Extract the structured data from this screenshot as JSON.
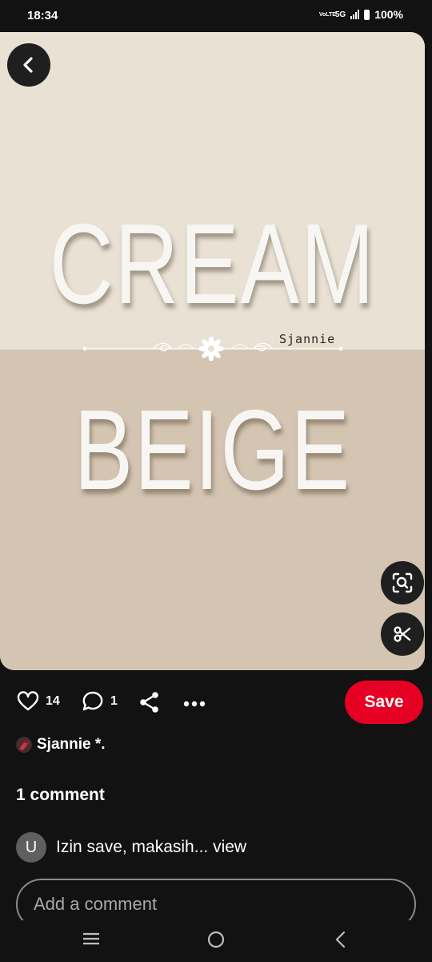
{
  "status_bar": {
    "time": "18:34",
    "volte": "VoLTE",
    "network": "5G",
    "battery": "100%"
  },
  "pin": {
    "title_word_1": "CREAM",
    "title_word_2": "BEIGE",
    "signature": "Sjannie",
    "colors": {
      "top": "#e8e1d4",
      "bottom": "#d3c5b1"
    }
  },
  "actions": {
    "likes": "14",
    "comments": "1",
    "save_label": "Save"
  },
  "author": {
    "name": "Sjannie *."
  },
  "comments_section": {
    "heading": "1 comment",
    "items": [
      {
        "avatar_letter": "U",
        "text": "Izin save, makasih... view"
      }
    ],
    "input_placeholder": "Add a comment"
  },
  "icons": {
    "back": "chevron-left-icon",
    "visual_search": "visual-search-icon",
    "scissors": "scissors-icon",
    "heart": "heart-icon",
    "comment": "comment-bubble-icon",
    "share": "share-icon",
    "more": "more-dots-icon"
  },
  "theme": {
    "accent": "#e60023",
    "background": "#121212"
  }
}
